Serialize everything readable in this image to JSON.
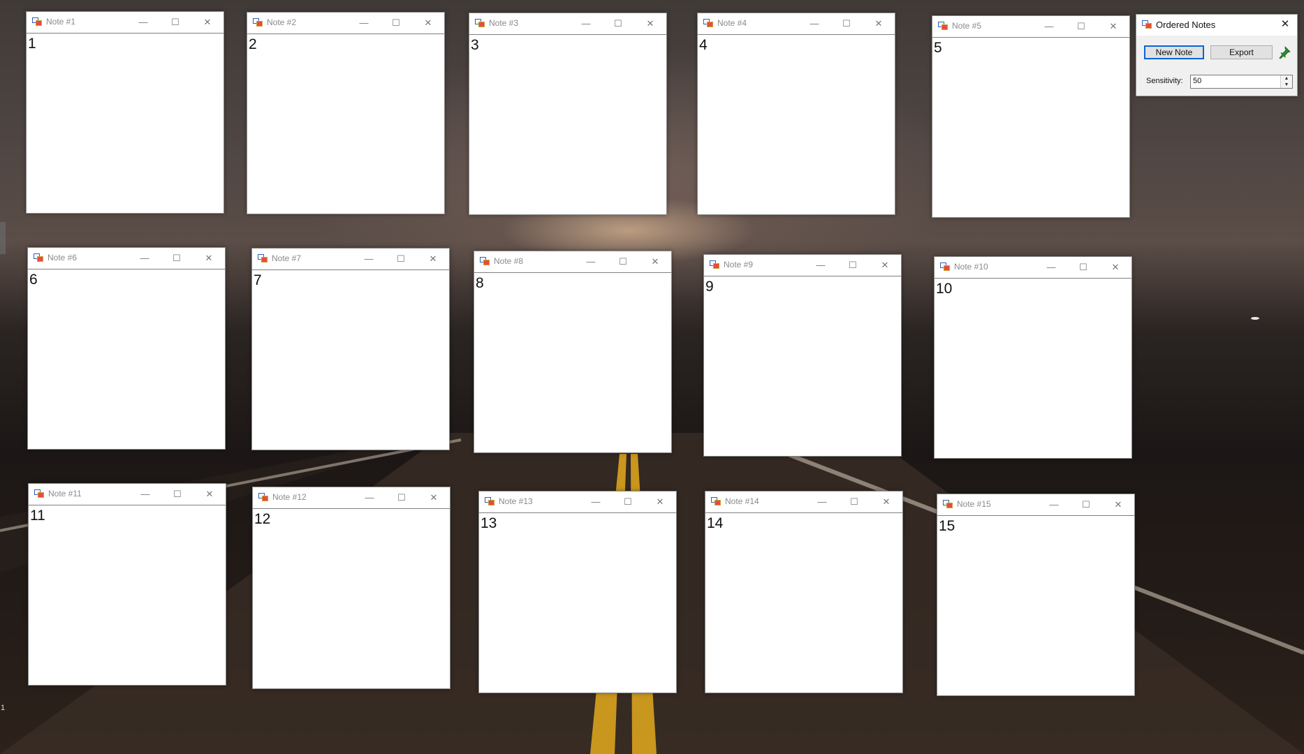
{
  "notes": [
    {
      "title": "Note #1",
      "text": "1"
    },
    {
      "title": "Note #2",
      "text": "2"
    },
    {
      "title": "Note #3",
      "text": "3"
    },
    {
      "title": "Note #4",
      "text": "4"
    },
    {
      "title": "Note #5",
      "text": "5"
    },
    {
      "title": "Note #6",
      "text": "6"
    },
    {
      "title": "Note #7",
      "text": "7"
    },
    {
      "title": "Note #8",
      "text": "8"
    },
    {
      "title": "Note #9",
      "text": "9"
    },
    {
      "title": "Note #10",
      "text": "10"
    },
    {
      "title": "Note #11",
      "text": "11"
    },
    {
      "title": "Note #12",
      "text": "12"
    },
    {
      "title": "Note #13",
      "text": "13"
    },
    {
      "title": "Note #14",
      "text": "14"
    },
    {
      "title": "Note #15",
      "text": "15"
    }
  ],
  "window_controls": {
    "minimize": "—",
    "maximize": "☐",
    "close": "✕"
  },
  "main": {
    "title": "Ordered Notes",
    "new_note_label": "New Note",
    "export_label": "Export",
    "sensitivity_label": "Sensitivity:",
    "sensitivity_value": "50",
    "pin_icon": "pin-icon"
  },
  "desktop": {
    "corner_text": "1"
  },
  "colors": {
    "focus_border": "#0a64d6",
    "pin": "#2e8b2e"
  }
}
